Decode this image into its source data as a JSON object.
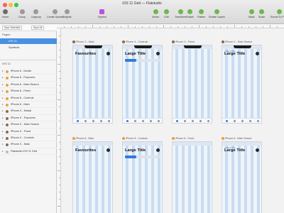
{
  "window": {
    "title": "iOS 11 Grid — Flatstudio",
    "traffic_colors": [
      "#fc5f57",
      "#fdbc2e",
      "#34c84a"
    ]
  },
  "toolbar": {
    "left": [
      {
        "label": "Insert",
        "icon": "plus-icon",
        "color": "#6b6b6b"
      },
      {
        "label": "Group",
        "icon": "group-icon",
        "color": "#9a9a9a"
      },
      {
        "label": "Ungroup",
        "icon": "ungroup-icon",
        "color": "#9a9a9a"
      },
      {
        "label": "Create Symbol",
        "icon": "symbol-icon",
        "color": "#9a9a9a"
      },
      {
        "label": "Original",
        "icon": "original-icon",
        "color": "#9a9a9a"
      }
    ],
    "symbol": {
      "label": "Symbol",
      "icon": "symbol-icon",
      "color": "#c04ee0"
    },
    "right": [
      {
        "label": "Vector",
        "icon": "vector-icon",
        "color": "#6db84f"
      },
      {
        "label": "Edit",
        "icon": "edit-icon",
        "color": "#6db84f"
      },
      {
        "label": "Transform",
        "icon": "transform-icon",
        "color": "#6db84f"
      },
      {
        "label": "Rotate",
        "icon": "rotate-icon",
        "color": "#6db84f"
      },
      {
        "label": "Flatten",
        "icon": "flatten-icon",
        "color": "#6db84f"
      },
      {
        "label": "Rotate Copies",
        "icon": "rotate-copies-icon",
        "color": "#6db84f"
      }
    ],
    "far_right": [
      {
        "label": "Mask",
        "icon": "mask-icon",
        "color": "#6db84f"
      },
      {
        "label": "Scale",
        "icon": "scale-icon",
        "color": "#6db84f"
      },
      {
        "label": "Round To Pixel",
        "icon": "round-icon",
        "color": "#6db84f"
      }
    ]
  },
  "sidebar": {
    "sync_selected": "Sync Selected",
    "sync_all": "Sync All",
    "pages_header": "Pages",
    "pages": [
      "iOS 11",
      "Symbols"
    ],
    "layers_title": "iOS 11",
    "layers": [
      {
        "name": "iPhone 8 - Modal",
        "color": "#e8a33d"
      },
      {
        "name": "iPhone 8 - Popovers",
        "color": "#e8a33d"
      },
      {
        "name": "iPhone 8 - Main Search",
        "color": "#e8a33d"
      },
      {
        "name": "iPhone 8 - Fixed",
        "color": "#e8a33d"
      },
      {
        "name": "iPhone 8 - Controls",
        "color": "#e8a33d"
      },
      {
        "name": "iPhone 8 - Main",
        "color": "#e8a33d"
      },
      {
        "name": "iPhone X - Modal",
        "color": "#8a6a55"
      },
      {
        "name": "iPhone X - Popovers",
        "color": "#8a6a55"
      },
      {
        "name": "iPhone X - Main Search",
        "color": "#8a6a55"
      },
      {
        "name": "iPhone X - Fixed",
        "color": "#8a6a55"
      },
      {
        "name": "iPhone X - Controls",
        "color": "#8a6a55"
      },
      {
        "name": "iPhone X - Main",
        "color": "#8a6a55"
      },
      {
        "name": "Flatstudio iOS 11 Grid",
        "color": "#bbbbbb"
      }
    ]
  },
  "artboards": [
    {
      "label": "iPhone X - Main",
      "title": "Favourites",
      "dot": "#8a6a55",
      "search": false,
      "nav": ""
    },
    {
      "label": "iPhone X - Controls",
      "title": "Large Title",
      "dot": "#8a6a55",
      "search": true,
      "nav": ""
    },
    {
      "label": "iPhone X - Fixed",
      "title": "",
      "dot": "#8a6a55",
      "search": false,
      "nav": ""
    },
    {
      "label": "iPhone X - Main Search",
      "title": "Large Title",
      "dot": "#8a6a55",
      "search": false,
      "nav": "< Back Title"
    },
    {
      "label": "iPhone 8 - Main",
      "title": "Favourites",
      "dot": "#e8a33d",
      "search": false,
      "nav": ""
    },
    {
      "label": "iPhone 8 - Controls",
      "title": "Large Title",
      "dot": "#e8a33d",
      "search": true,
      "nav": ""
    },
    {
      "label": "iPhone 8 - Fixed",
      "title": "",
      "dot": "#e8a33d",
      "search": false,
      "nav": ""
    },
    {
      "label": "iPhone 8 - Main Search",
      "title": "Large Title",
      "dot": "#e8a33d",
      "search": false,
      "nav": "< Back Title"
    }
  ],
  "colors": {
    "selection": "#4a90e2",
    "accent": "#2f7cd6"
  }
}
